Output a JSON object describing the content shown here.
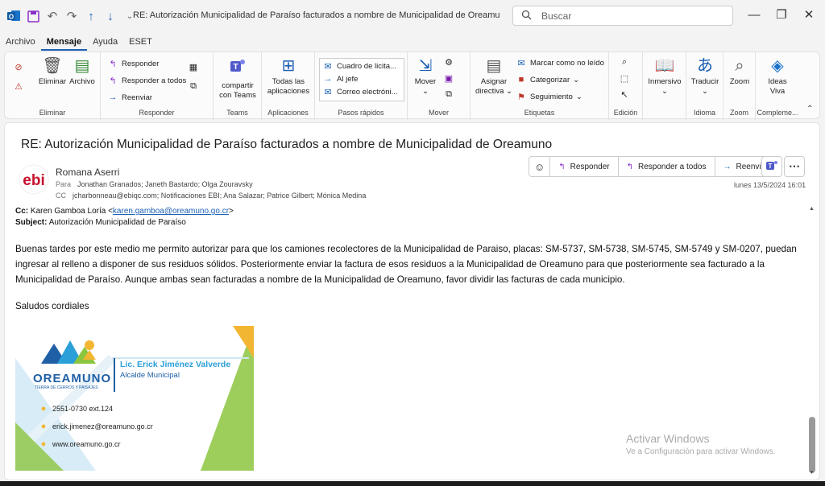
{
  "window": {
    "title": "RE:  Autorización Municipalidad de Paraíso facturados a nombre de Municipalidad de Oreamuno  -  Mensaje (H...",
    "search_placeholder": "Buscar"
  },
  "menu": [
    "Archivo",
    "Mensaje",
    "Ayuda",
    "ESET"
  ],
  "ribbon": {
    "eliminar": {
      "delete": "Eliminar",
      "archive": "Archivo",
      "label": "Eliminar"
    },
    "responder": {
      "reply": "Responder",
      "reply_all": "Responder a todos",
      "forward": "Reenviar",
      "label": "Responder"
    },
    "teams": {
      "share": "compartir con Teams",
      "share_l1": "compartir",
      "share_l2": "con Teams",
      "label": "Teams"
    },
    "apps": {
      "all_l1": "Todas las",
      "all_l2": "aplicaciones",
      "label": "Aplicaciones"
    },
    "quick": {
      "items": [
        "Cuadro de licita...",
        "Al jefe",
        "Correo electróni..."
      ],
      "label": "Pasos rápidos"
    },
    "mover": {
      "move": "Mover",
      "label": "Mover"
    },
    "etiquetas": {
      "assign_l1": "Asignar",
      "assign_l2": "directiva",
      "unread": "Marcar como no leído",
      "categorize": "Categorizar",
      "followup": "Seguimiento",
      "label": "Etiquetas"
    },
    "edicion": {
      "label": "Edición"
    },
    "inmersivo": {
      "label": "Inmersivo"
    },
    "idioma": {
      "translate": "Traducir",
      "label": "Idioma"
    },
    "zoom": {
      "zoom": "Zoom",
      "label": "Zoom"
    },
    "comple": {
      "ideas_l1": "Ideas",
      "ideas_l2": "Viva",
      "label": "Compleme..."
    }
  },
  "message": {
    "subject": "RE:  Autorización Municipalidad de Paraíso facturados a nombre de Municipalidad de Oreamuno",
    "sender": "Romana Aserri",
    "to_label": "Para",
    "to": "Jonathan Granados; Janeth Bastardo; Olga Zouravsky",
    "cc_label": "CC",
    "cc": "jcharbonneau@ebiqc.com; Notificaciones EBI; Ana Salazar; Patrice Gilbert; Mónica Medina",
    "date": "lunes 13/5/2024 16:01",
    "actions": {
      "reply": "Responder",
      "reply_all": "Responder a todos",
      "forward": "Reenviar"
    },
    "cc_line_label": "Cc:",
    "cc_line_name": "Karen Gamboa Loría <",
    "cc_line_email": "karen.gamboa@oreamuno.go.cr",
    "cc_line_end": ">",
    "subject_line_label": "Subject:",
    "subject_line": "Autorización Municipalidad de Paraíso",
    "body": "Buenas tardes por este medio me permito autorizar para que los camiones recolectores de la Municipalidad de Paraiso, placas: SM-5737, SM-5738, SM-5745, SM-5749 y SM-0207, puedan ingresar al relleno a disponer de sus residuos sólidos. Posteriormente enviar la factura de esos residuos a la Municipalidad de Oreamuno para que posteriormente sea facturado a la Municipalidad de Paraíso. Aunque ambas sean facturadas a nombre de la Municipalidad de Oreamuno, favor dividir las facturas de cada municipio.",
    "closing": "Saludos cordiales"
  },
  "signature": {
    "name": "Lic. Erick Jiménez Valverde",
    "role": "Alcalde Municipal",
    "phone": "2551-0730 ext.124",
    "email": "erick.jimenez@oreamuno.go.cr",
    "web": "www.oreamuno.go.cr",
    "org": "OREAMUNO",
    "org_tag": "TIERRA DE CERROS Y PAISAJES"
  },
  "watermark": {
    "line1": "Activar Windows",
    "line2": "Ve a Configuración para activar Windows."
  },
  "colors": {
    "accent": "#1a5fb4",
    "brand_blue": "#1f5fa6",
    "brand_yellow": "#f2b632",
    "brand_green": "#8cc63f"
  }
}
